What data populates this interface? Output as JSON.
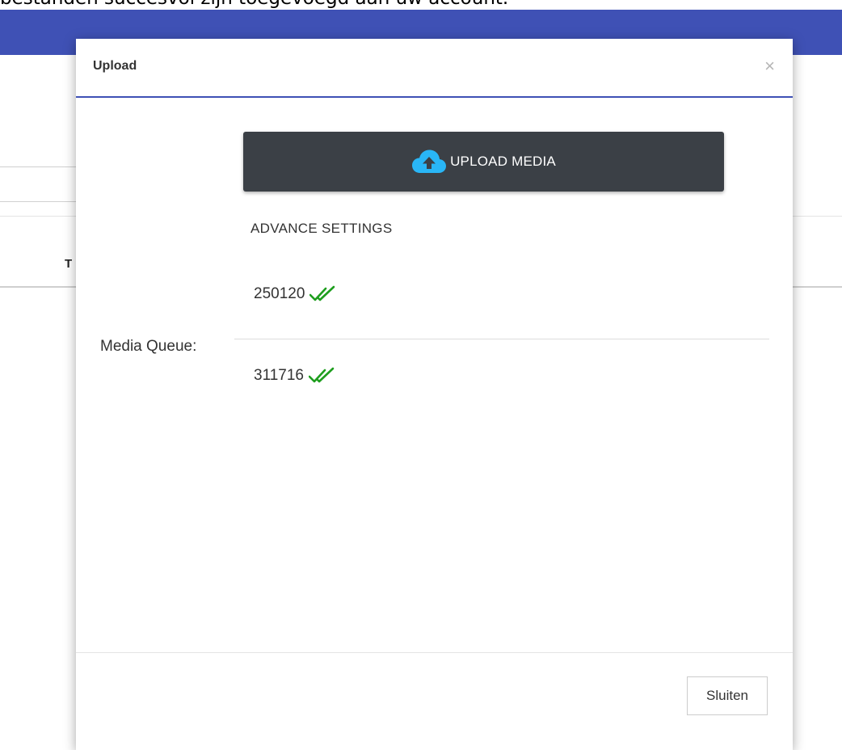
{
  "page": {
    "caption": "bestanden succesvol zijn toegevoegd aan uw account."
  },
  "background": {
    "column_letter": "T"
  },
  "modal": {
    "title": "Upload",
    "close_symbol": "×",
    "upload_button": {
      "label": "UPLOAD MEDIA",
      "icon": "cloud-upload-icon"
    },
    "advance_settings_label": "ADVANCE SETTINGS",
    "queue": {
      "label": "Media Queue:",
      "items": [
        {
          "id": "250120",
          "status_icon": "double-check-icon"
        },
        {
          "id": "311716",
          "status_icon": "double-check-icon"
        }
      ]
    },
    "footer": {
      "close_label": "Sluiten"
    }
  },
  "colors": {
    "header_bar": "#3f51b5",
    "upload_button_bg": "#3b4046",
    "cloud_icon": "#29b6f6",
    "check_icon": "#1e9e1e"
  }
}
